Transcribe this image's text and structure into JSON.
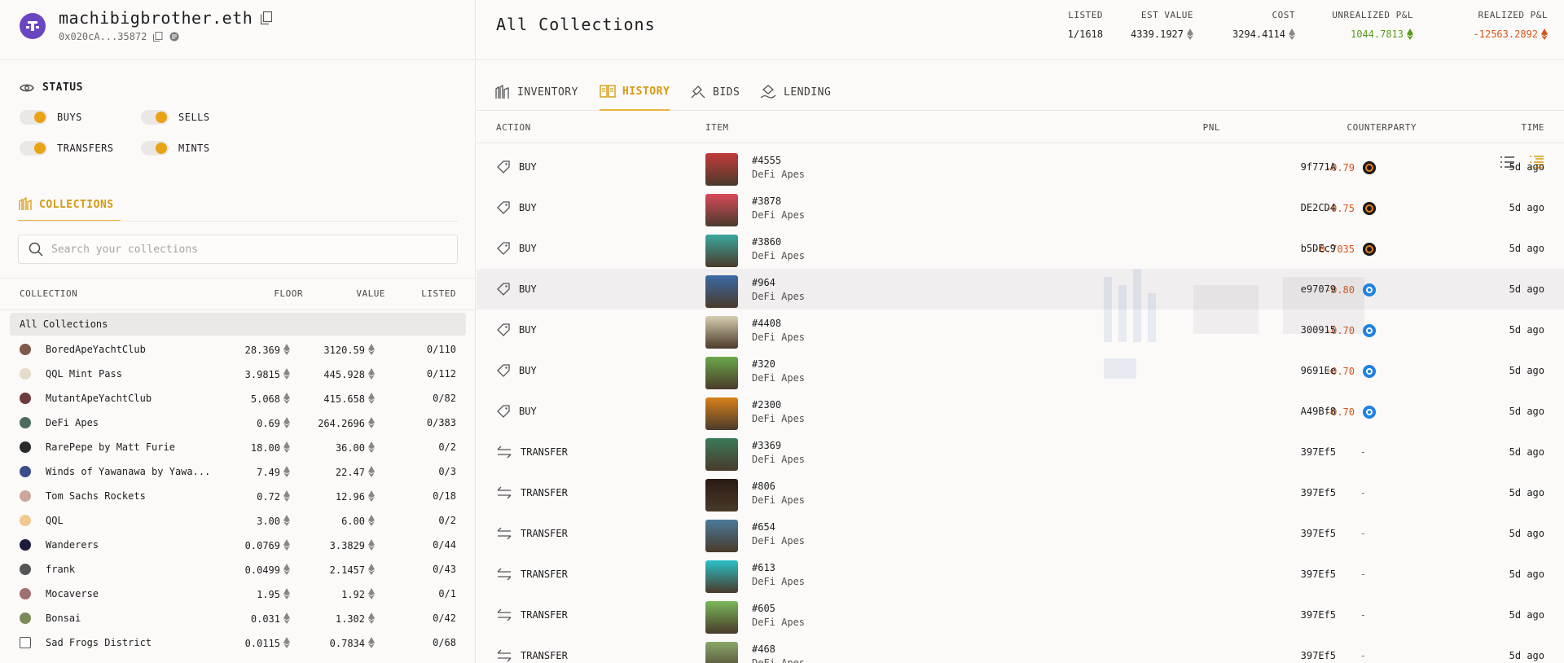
{
  "profile": {
    "ens": "machibigbrother.eth",
    "address": "0x020cA...35872"
  },
  "status": {
    "title": "STATUS",
    "toggles": [
      {
        "label": "BUYS",
        "on": true
      },
      {
        "label": "SELLS",
        "on": true
      },
      {
        "label": "TRANSFERS",
        "on": true
      },
      {
        "label": "MINTS",
        "on": true
      }
    ]
  },
  "collections": {
    "tab_label": "COLLECTIONS",
    "search_placeholder": "Search your collections",
    "headers": {
      "collection": "COLLECTION",
      "floor": "FLOOR",
      "value": "VALUE",
      "listed": "LISTED"
    },
    "all_label": "All Collections",
    "rows": [
      {
        "name": "BoredApeYachtClub",
        "floor": "28.369",
        "value": "3120.59",
        "listed": "0/110",
        "color": "#7b5a4a"
      },
      {
        "name": "QQL Mint Pass",
        "floor": "3.9815",
        "value": "445.928",
        "listed": "0/112",
        "color": "#e4dccb"
      },
      {
        "name": "MutantApeYachtClub",
        "floor": "5.068",
        "value": "415.658",
        "listed": "0/82",
        "color": "#6a3c3c"
      },
      {
        "name": "DeFi Apes",
        "floor": "0.69",
        "value": "264.2696",
        "listed": "0/383",
        "color": "#4b6b5e"
      },
      {
        "name": "RarePepe by Matt Furie",
        "floor": "18.00",
        "value": "36.00",
        "listed": "0/2",
        "color": "#2a2a2a"
      },
      {
        "name": "Winds of Yawanawa by Yawa...",
        "floor": "7.49",
        "value": "22.47",
        "listed": "0/3",
        "color": "#3a4c8c"
      },
      {
        "name": "Tom Sachs Rockets",
        "floor": "0.72",
        "value": "12.96",
        "listed": "0/18",
        "color": "#c9a89a"
      },
      {
        "name": "QQL",
        "floor": "3.00",
        "value": "6.00",
        "listed": "0/2",
        "color": "#f0c98c"
      },
      {
        "name": "Wanderers",
        "floor": "0.0769",
        "value": "3.3829",
        "listed": "0/44",
        "color": "#1c1c3a"
      },
      {
        "name": "frank",
        "floor": "0.0499",
        "value": "2.1457",
        "listed": "0/43",
        "color": "#555"
      },
      {
        "name": "Mocaverse",
        "floor": "1.95",
        "value": "1.92",
        "listed": "0/1",
        "color": "#a07070"
      },
      {
        "name": "Bonsai",
        "floor": "0.031",
        "value": "1.302",
        "listed": "0/42",
        "color": "#7a8a5a"
      },
      {
        "name": "Sad Frogs District",
        "floor": "0.0115",
        "value": "0.7834",
        "listed": "0/68",
        "color": "#ffffff"
      }
    ]
  },
  "header": {
    "title": "All Collections",
    "stats": {
      "listed": {
        "label": "LISTED",
        "value": "1/1618"
      },
      "est_value": {
        "label": "EST VALUE",
        "value": "4339.1927"
      },
      "cost": {
        "label": "COST",
        "value": "3294.4114"
      },
      "unrealized": {
        "label": "UNREALIZED P&L",
        "value": "1044.7813"
      },
      "realized": {
        "label": "REALIZED P&L",
        "value": "-12563.2892"
      }
    }
  },
  "colors": {
    "accent": "#d69a10",
    "negative": "#d4541a",
    "positive": "#5a9a1a"
  },
  "tabs": [
    {
      "label": "INVENTORY",
      "icon": "inventory-icon"
    },
    {
      "label": "HISTORY",
      "icon": "history-icon",
      "active": true
    },
    {
      "label": "BIDS",
      "icon": "bids-icon"
    },
    {
      "label": "LENDING",
      "icon": "lending-icon"
    }
  ],
  "history": {
    "headers": {
      "action": "ACTION",
      "item": "ITEM",
      "pnl": "PNL",
      "counterparty": "COUNTERPARTY",
      "time": "TIME"
    },
    "rows": [
      {
        "action": "BUY",
        "item": "#4555",
        "collection": "DeFi Apes",
        "pnl": "-0.79",
        "market": "blur",
        "counterparty": "9f771A",
        "time": "5d ago",
        "thumb": "#c23a3a"
      },
      {
        "action": "BUY",
        "item": "#3878",
        "collection": "DeFi Apes",
        "pnl": "-0.75",
        "market": "blur",
        "counterparty": "DE2CD4",
        "time": "5d ago",
        "thumb": "#d84a5a"
      },
      {
        "action": "BUY",
        "item": "#3860",
        "collection": "DeFi Apes",
        "pnl": "-0.7035",
        "market": "blur",
        "counterparty": "b5DEc9",
        "time": "5d ago",
        "thumb": "#3aa8a0"
      },
      {
        "action": "BUY",
        "item": "#964",
        "collection": "DeFi Apes",
        "pnl": "-0.80",
        "market": "opensea",
        "counterparty": "e97079",
        "time": "5d ago",
        "thumb": "#3a6aa8"
      },
      {
        "action": "BUY",
        "item": "#4408",
        "collection": "DeFi Apes",
        "pnl": "-0.70",
        "market": "opensea",
        "counterparty": "300915",
        "time": "5d ago",
        "thumb": "#d8cdb0"
      },
      {
        "action": "BUY",
        "item": "#320",
        "collection": "DeFi Apes",
        "pnl": "-0.70",
        "market": "opensea",
        "counterparty": "9691Ee",
        "time": "5d ago",
        "thumb": "#6aa84a"
      },
      {
        "action": "BUY",
        "item": "#2300",
        "collection": "DeFi Apes",
        "pnl": "-0.70",
        "market": "opensea",
        "counterparty": "A49Bf8",
        "time": "5d ago",
        "thumb": "#d8801a"
      },
      {
        "action": "TRANSFER",
        "item": "#3369",
        "collection": "DeFi Apes",
        "pnl": "-",
        "market": "",
        "counterparty": "397Ef5",
        "time": "5d ago",
        "thumb": "#3a7a5a"
      },
      {
        "action": "TRANSFER",
        "item": "#806",
        "collection": "DeFi Apes",
        "pnl": "-",
        "market": "",
        "counterparty": "397Ef5",
        "time": "5d ago",
        "thumb": "#2a1a14"
      },
      {
        "action": "TRANSFER",
        "item": "#654",
        "collection": "DeFi Apes",
        "pnl": "-",
        "market": "",
        "counterparty": "397Ef5",
        "time": "5d ago",
        "thumb": "#4a7a9a"
      },
      {
        "action": "TRANSFER",
        "item": "#613",
        "collection": "DeFi Apes",
        "pnl": "-",
        "market": "",
        "counterparty": "397Ef5",
        "time": "5d ago",
        "thumb": "#2ac0c8"
      },
      {
        "action": "TRANSFER",
        "item": "#605",
        "collection": "DeFi Apes",
        "pnl": "-",
        "market": "",
        "counterparty": "397Ef5",
        "time": "5d ago",
        "thumb": "#7ab85a"
      },
      {
        "action": "TRANSFER",
        "item": "#468",
        "collection": "DeFi Apes",
        "pnl": "-",
        "market": "",
        "counterparty": "397Ef5",
        "time": "5d ago",
        "thumb": "#8aa86a"
      }
    ]
  }
}
